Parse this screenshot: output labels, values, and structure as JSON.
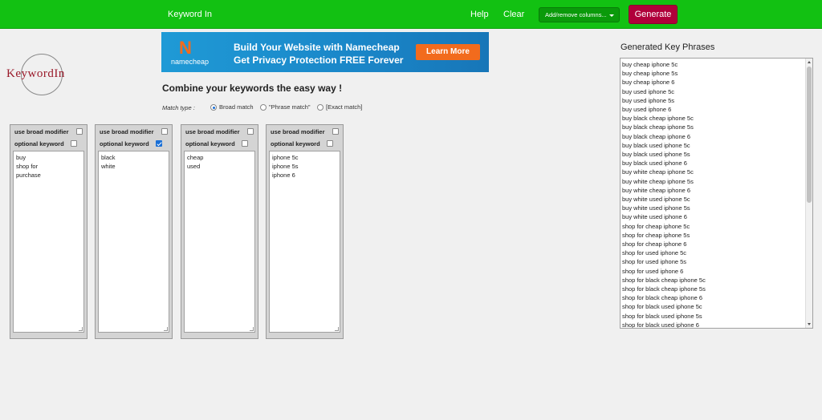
{
  "navbar": {
    "brand": "Keyword In",
    "help": "Help",
    "clear": "Clear",
    "add_remove_columns": "Add/remove columns...",
    "generate": "Generate",
    "colors": {
      "bar": "#12c112",
      "generate": "#b0003a"
    }
  },
  "logo": {
    "text": "KeywordIn"
  },
  "banner": {
    "brand": "namecheap",
    "line1": "Build Your Website with Namecheap",
    "line2": "Get Privacy Protection FREE Forever",
    "cta": "Learn More"
  },
  "headline": "Combine your keywords the easy way !",
  "match_type": {
    "label": "Match type :",
    "options": [
      "Broad match",
      "\"Phrase match\"",
      "[Exact match]"
    ],
    "selected": "Broad match"
  },
  "columns": [
    {
      "broad_label": "use broad modifier",
      "broad_checked": false,
      "optional_label": "optional keyword",
      "optional_checked": false,
      "lines": [
        "buy",
        "shop for",
        "purchase"
      ]
    },
    {
      "broad_label": "use broad modifier",
      "broad_checked": false,
      "optional_label": "optional keyword",
      "optional_checked": true,
      "lines": [
        "black",
        "white"
      ]
    },
    {
      "broad_label": "use broad modifier",
      "broad_checked": false,
      "optional_label": "optional keyword",
      "optional_checked": false,
      "lines": [
        "cheap",
        "used"
      ]
    },
    {
      "broad_label": "use broad modifier",
      "broad_checked": false,
      "optional_label": "optional keyword",
      "optional_checked": false,
      "lines": [
        "iphone 5c",
        "iphone 5s",
        "iphone 6"
      ]
    }
  ],
  "output": {
    "title": "Generated Key Phrases",
    "lines": [
      "buy cheap iphone 5c",
      "buy cheap iphone 5s",
      "buy cheap iphone 6",
      "buy used iphone 5c",
      "buy used iphone 5s",
      "buy used iphone 6",
      "buy black cheap iphone 5c",
      "buy black cheap iphone 5s",
      "buy black cheap iphone 6",
      "buy black used iphone 5c",
      "buy black used iphone 5s",
      "buy black used iphone 6",
      "buy white cheap iphone 5c",
      "buy white cheap iphone 5s",
      "buy white cheap iphone 6",
      "buy white used iphone 5c",
      "buy white used iphone 5s",
      "buy white used iphone 6",
      "shop for cheap iphone 5c",
      "shop for cheap iphone 5s",
      "shop for cheap iphone 6",
      "shop for used iphone 5c",
      "shop for used iphone 5s",
      "shop for used iphone 6",
      "shop for black cheap iphone 5c",
      "shop for black cheap iphone 5s",
      "shop for black cheap iphone 6",
      "shop for black used iphone 5c",
      "shop for black used iphone 5s",
      "shop for black used iphone 6"
    ]
  }
}
